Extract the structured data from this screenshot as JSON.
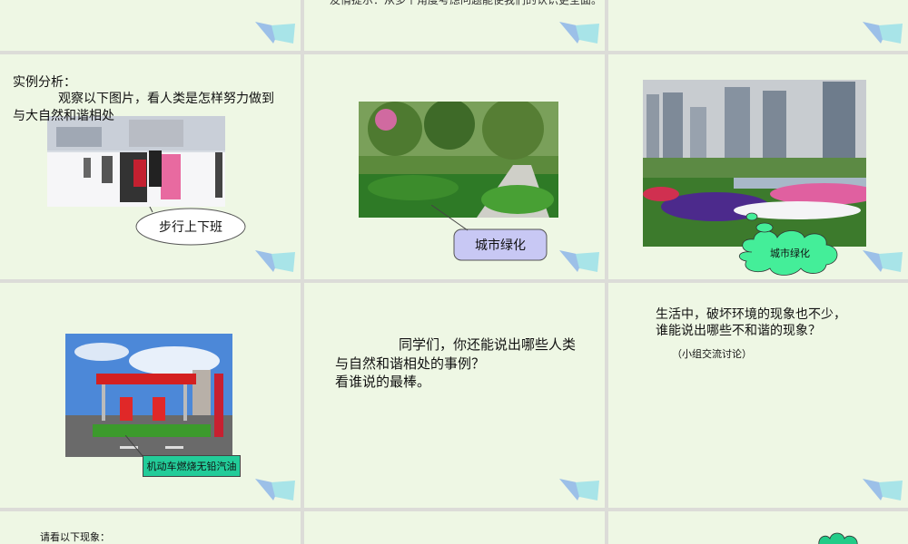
{
  "slides": {
    "s1": {},
    "s2": {
      "top_text": "友情提示：从多个角度考虑问题能使我们的认识更全面。"
    },
    "s3": {},
    "s4": {
      "heading": "实例分析：",
      "body": "观察以下图片，看人类是怎样努力做到与大自然和谐相处",
      "callout": "步行上下班"
    },
    "s5": {
      "callout": "城市绿化"
    },
    "s6": {
      "callout": "城市绿化"
    },
    "s7": {
      "callout": "机动车燃烧无铅汽油"
    },
    "s8": {
      "line1": "同学们，你还能说出哪些人类",
      "line2": "与自然和谐相处的事例？",
      "line3": "看谁说的最棒。"
    },
    "s9": {
      "line1": "生活中，破坏环境的现象也不少，",
      "line2": "谁能说出哪些不和谐的现象？",
      "note": "（小组交流讨论）"
    },
    "s10": {
      "text": "请看以下现象："
    },
    "s11": {},
    "s12": {}
  },
  "colors": {
    "slide_bg": "#eef7e4",
    "gap": "#dcdcd8",
    "deco_blue": "#9cc0e8",
    "deco_cyan": "#a8e4e8",
    "callout_purple": "#c8c8f4",
    "callout_green": "#22cc99",
    "cloud_green": "#44ee99"
  }
}
